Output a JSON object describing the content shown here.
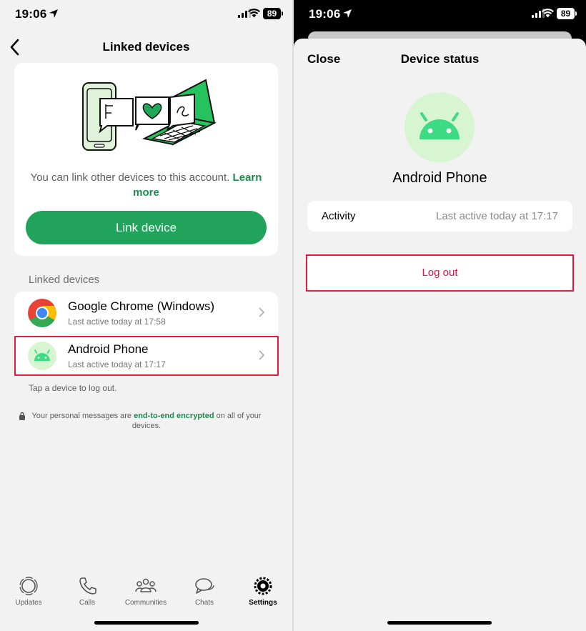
{
  "colors": {
    "accent_green": "#21a35c",
    "link_green": "#1f8a4d",
    "danger_red": "#e0143f",
    "highlight_red": "#e11d3d",
    "android_green": "#3ddc84"
  },
  "left": {
    "status": {
      "time": "19:06",
      "battery": "89"
    },
    "nav": {
      "title": "Linked devices",
      "back_icon": "chevron-left-icon"
    },
    "promo": {
      "text": "You can link other devices to this account.",
      "learn_more": "Learn more",
      "button_label": "Link device"
    },
    "section_label": "Linked devices",
    "devices": [
      {
        "name": "Google Chrome (Windows)",
        "status": "Last active today at 17:58",
        "icon": "chrome-icon"
      },
      {
        "name": "Android Phone",
        "status": "Last active today at 17:17",
        "icon": "android-icon"
      }
    ],
    "tap_hint": "Tap a device to log out.",
    "encryption": {
      "prefix": "Your personal messages are",
      "link": "end-to-end encrypted",
      "suffix": "on all of your devices."
    },
    "tabs": [
      {
        "label": "Updates",
        "icon": "updates-icon"
      },
      {
        "label": "Calls",
        "icon": "phone-icon"
      },
      {
        "label": "Communities",
        "icon": "communities-icon"
      },
      {
        "label": "Chats",
        "icon": "chats-icon"
      },
      {
        "label": "Settings",
        "icon": "gear-icon",
        "active": true
      }
    ]
  },
  "right": {
    "status": {
      "time": "19:06",
      "battery": "89"
    },
    "sheet": {
      "close_label": "Close",
      "title": "Device status",
      "device_name": "Android Phone",
      "activity_label": "Activity",
      "activity_value": "Last active today at 17:17",
      "logout_label": "Log out"
    }
  }
}
